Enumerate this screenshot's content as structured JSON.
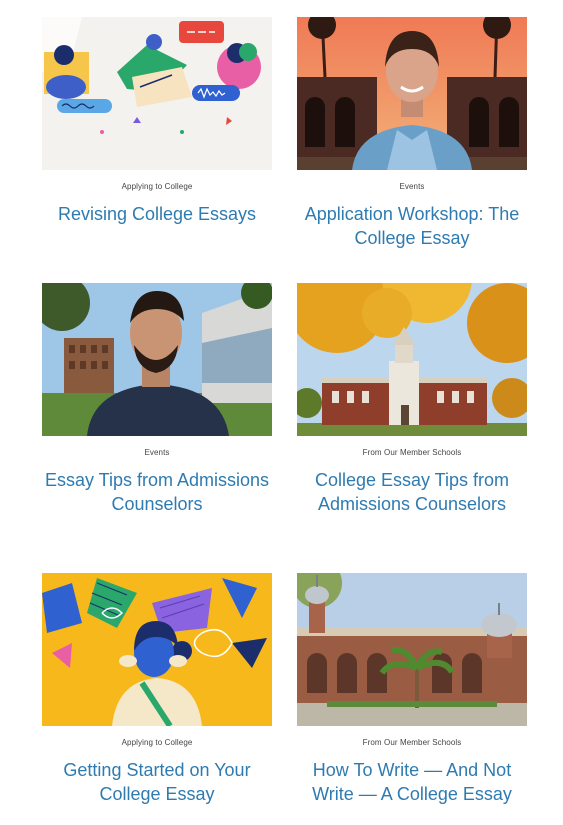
{
  "colors": {
    "title": "#2e7bb1",
    "category": "#444444"
  },
  "cards": [
    {
      "category": "Applying to College",
      "title": "Revising College Essays",
      "thumbnail": "illustration-people-chat"
    },
    {
      "category": "Events",
      "title": "Application Workshop: The College Essay",
      "thumbnail": "photo-presenter-courtyard"
    },
    {
      "category": "Events",
      "title": "Essay Tips from Admissions Counselors",
      "thumbnail": "photo-presenter-campus"
    },
    {
      "category": "From Our Member Schools",
      "title": "College Essay Tips from Admissions Counselors",
      "thumbnail": "photo-campus-autumn"
    },
    {
      "category": "Applying to College",
      "title": "Getting Started on Your College Essay",
      "thumbnail": "illustration-thinking-person"
    },
    {
      "category": "From Our Member Schools",
      "title": "How To Write — And Not Write — A College Essay",
      "thumbnail": "photo-minaret-building"
    }
  ]
}
